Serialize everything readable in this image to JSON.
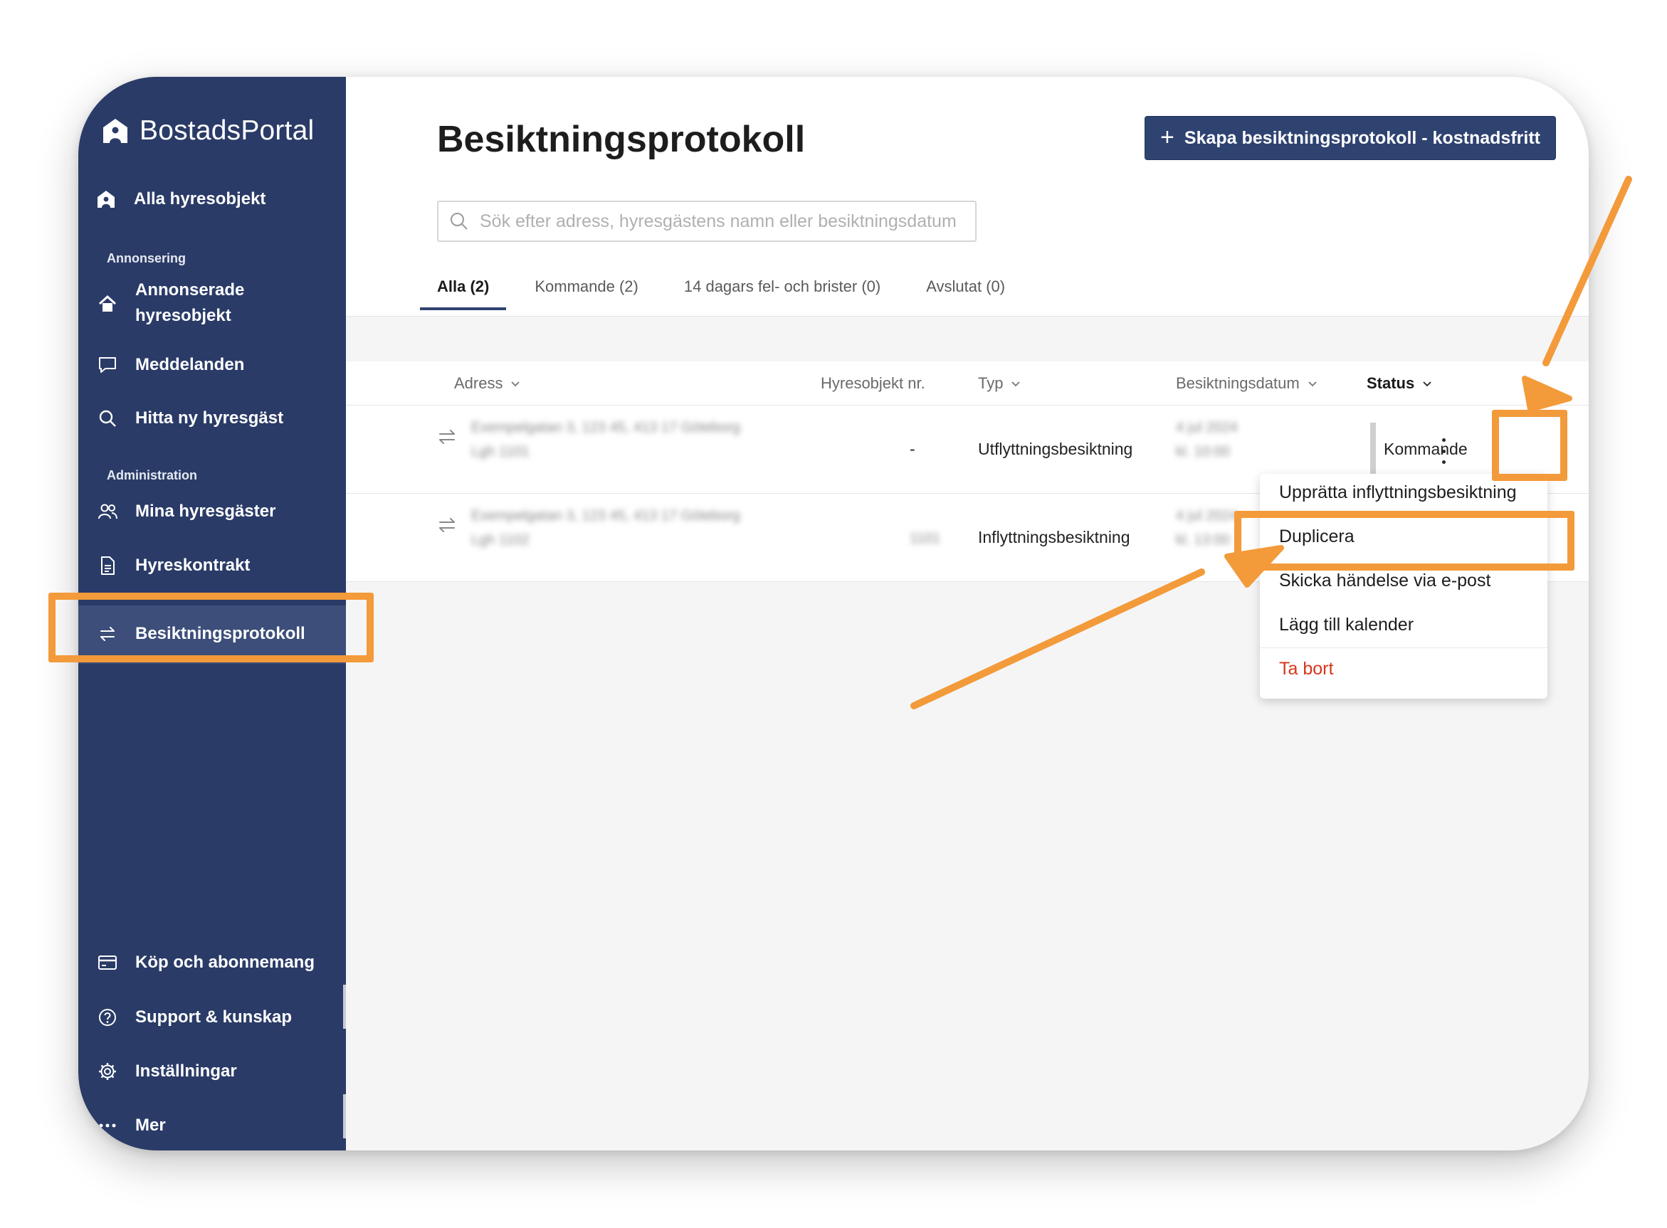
{
  "brand": {
    "name": "BostadsPortal"
  },
  "sidebar": {
    "top_item": "Alla hyresobjekt",
    "sections": [
      {
        "label": "Annonsering"
      },
      {
        "label": "Administration"
      }
    ],
    "items": [
      {
        "label_line1": "Annonserade",
        "label_line2": "hyresobjekt",
        "icon": "house-icon"
      },
      {
        "label": "Meddelanden",
        "icon": "chat-icon"
      },
      {
        "label": "Hitta ny hyresgäst",
        "icon": "search-icon"
      },
      {
        "label": "Mina hyresgäster",
        "icon": "users-icon"
      },
      {
        "label": "Hyreskontrakt",
        "icon": "document-icon"
      },
      {
        "label": "Besiktningsprotokoll",
        "icon": "swap-arrows-icon",
        "active": true
      }
    ],
    "bottom_items": [
      {
        "label": "Köp och abonnemang",
        "icon": "card-icon"
      },
      {
        "label": "Support & kunskap",
        "icon": "help-icon"
      },
      {
        "label": "Inställningar",
        "icon": "gear-icon"
      },
      {
        "label": "Mer",
        "icon": "more-icon"
      }
    ]
  },
  "main": {
    "title": "Besiktningsprotokoll",
    "create_button": {
      "icon": "plus-icon",
      "label": "Skapa besiktningsprotokoll - kostnadsfritt"
    },
    "search": {
      "placeholder": "Sök efter adress, hyresgästens namn eller besiktningsdatum",
      "value": ""
    },
    "tabs": [
      {
        "label": "Alla (2)",
        "active": true
      },
      {
        "label": "Kommande (2)"
      },
      {
        "label": "14 dagars fel- och brister (0)"
      },
      {
        "label": "Avslutat (0)"
      }
    ],
    "table": {
      "columns": [
        "Adress",
        "Hyresobjekt nr.",
        "Typ",
        "Besiktningsdatum",
        "Status"
      ],
      "rows": [
        {
          "address": "Exempelgatan 3, 123 45, 413 17 Göteborg",
          "address_sub": "Lgh 1101",
          "object_nr": "-",
          "type": "Utflyttningsbesiktning",
          "date": "4 jul 2024",
          "time": "kl. 10:00",
          "status": "Kommande"
        },
        {
          "address": "Exempelgatan 3, 123 45, 413 17 Göteborg",
          "address_sub": "Lgh 1102",
          "object_nr": "1101",
          "type": "Inflyttningsbesiktning",
          "date": "4 jul 2024",
          "time": "kl. 13:00",
          "status": ""
        }
      ]
    },
    "context_menu": {
      "items": [
        {
          "label": "Upprätta inflyttningsbesiktning"
        },
        {
          "label": "Duplicera",
          "highlighted": true
        },
        {
          "label": "Skicka händelse via e-post"
        },
        {
          "label": "Lägg till kalender"
        },
        {
          "label": "Ta bort",
          "danger": true
        }
      ]
    }
  },
  "annotations": {
    "color": "#f39a3a"
  },
  "colors": {
    "sidebar": "#2a3b67",
    "sidebar_active": "#3c4e79",
    "primary_button": "#2f4371",
    "danger": "#d4371e"
  }
}
